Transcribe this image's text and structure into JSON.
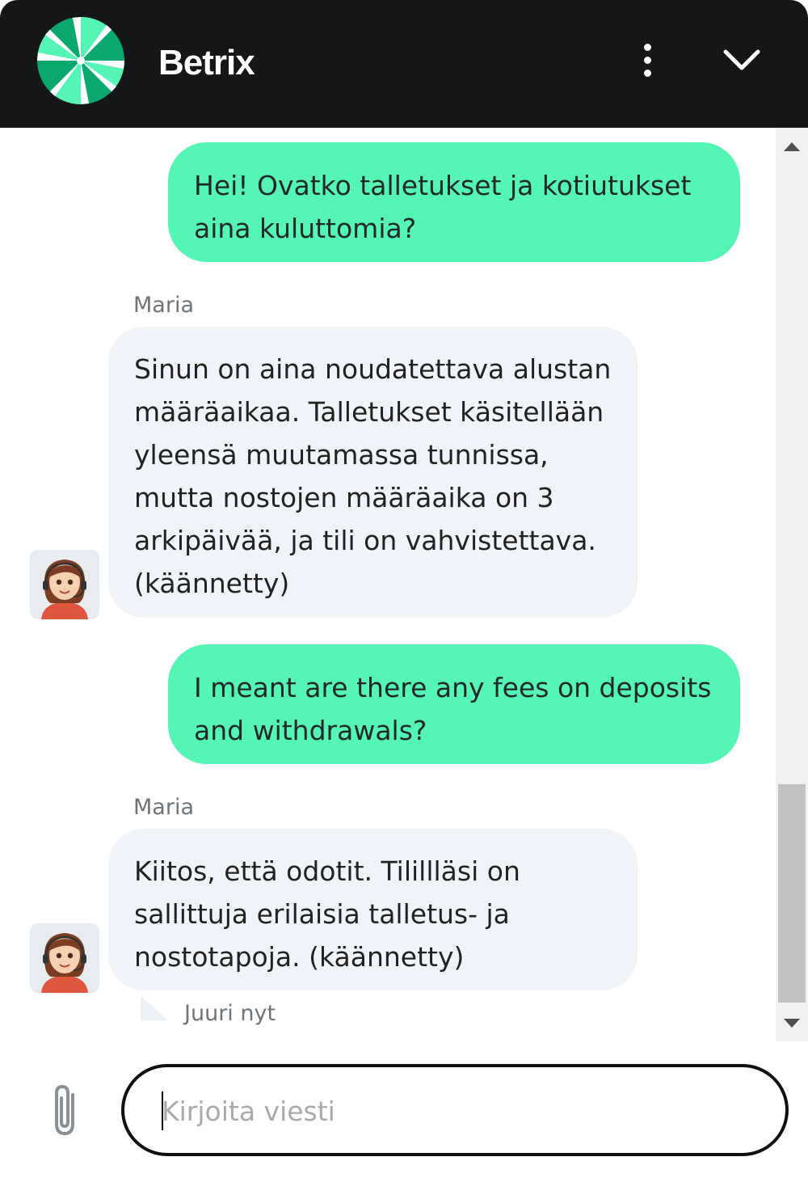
{
  "header": {
    "brand": "Betrix",
    "logo_icon": "pinwheel-logo-icon",
    "menu_icon": "vertical-dots-icon",
    "collapse_icon": "chevron-down-icon",
    "colors": {
      "background": "#141617",
      "logo_light": "#55f5b5",
      "logo_dark": "#0aa86e"
    }
  },
  "messages": [
    {
      "role": "user",
      "lines": [
        "Hei! Ovatko talletukset ja kotiutukset",
        "aina kuluttomia?"
      ]
    },
    {
      "role": "agent",
      "sender": "Maria",
      "lines": [
        "Sinun on aina noudatettava alustan",
        "määräaikaa. Talletukset käsitellään",
        "yleensä muutamassa tunnissa,",
        "mutta nostojen määräaika on 3",
        "arkipäivää, ja tili on vahvistettava.",
        "(käännetty)"
      ]
    },
    {
      "role": "user",
      "lines": [
        "I meant are there any fees on deposits",
        "and withdrawals?"
      ]
    },
    {
      "role": "agent",
      "sender": "Maria",
      "lines": [
        "Kiitos, että odotit. Tilillläsi on",
        "sallittuja erilaisia talletus- ja",
        "nostotapoja. (käännetty)"
      ]
    }
  ],
  "last_message_time": "Juuri nyt",
  "composer": {
    "placeholder": "Kirjoita viesti",
    "value": "",
    "attach_icon": "paperclip-icon"
  },
  "colors": {
    "user_bubble": "#55f5b5",
    "agent_bubble": "#f1f4f6",
    "meta_text": "#6f7479"
  }
}
